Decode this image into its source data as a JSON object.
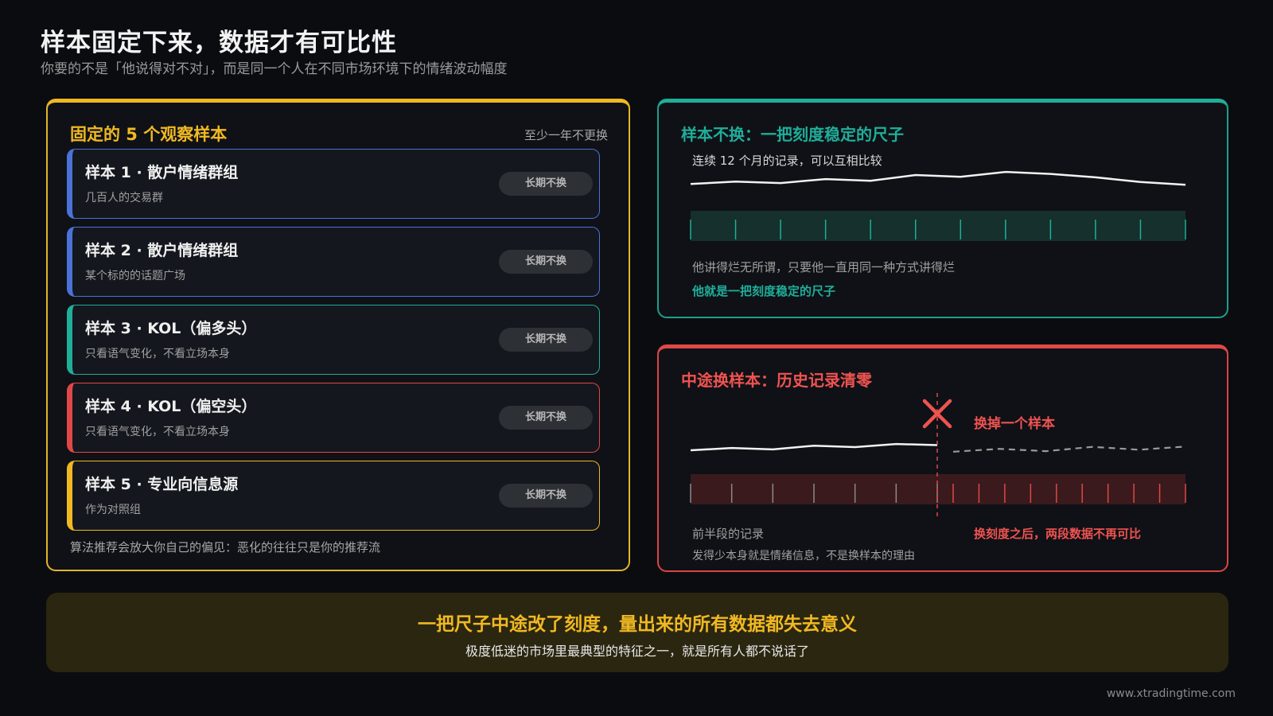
{
  "header": {
    "title": "样本固定下来，数据才有可比性",
    "subtitle": "你要的不是「他说得对不对」，而是同一个人在不同市场环境下的情绪波动幅度"
  },
  "left_panel": {
    "title": "固定的 5 个观察样本",
    "note": "至少一年不更换",
    "footer": "算法推荐会放大你自己的偏见：恶化的往往只是你的推荐流",
    "samples": [
      {
        "title": "样本 1 · 散户情绪群组",
        "desc": "几百人的交易群",
        "badge": "长期不换",
        "color": "#4a72d9"
      },
      {
        "title": "样本 2 · 散户情绪群组",
        "desc": "某个标的的话题广场",
        "badge": "长期不换",
        "color": "#4a72d9"
      },
      {
        "title": "样本 3 · KOL（偏多头）",
        "desc": "只看语气变化，不看立场本身",
        "badge": "长期不换",
        "color": "#1fae9a"
      },
      {
        "title": "样本 4 · KOL（偏空头）",
        "desc": "只看语气变化，不看立场本身",
        "badge": "长期不换",
        "color": "#e04848"
      },
      {
        "title": "样本 5 · 专业向信息源",
        "desc": "作为对照组",
        "badge": "长期不换",
        "color": "#f0b922"
      }
    ]
  },
  "top_right": {
    "title": "样本不换：一把刻度稳定的尺子",
    "subtitle": "连续 12 个月的记录，可以互相比较",
    "line1": "他讲得烂无所谓，只要他一直用同一种方式讲得烂",
    "line2": "他就是一把刻度稳定的尺子",
    "accent": "#1fae9a",
    "series": [
      0.55,
      0.63,
      0.58,
      0.72,
      0.66,
      0.86,
      0.8,
      0.97,
      0.9,
      0.78,
      0.62,
      0.52
    ]
  },
  "bottom_right": {
    "title": "中途换样本：历史记录清零",
    "marker_label": "换掉一个样本",
    "left_caption": "前半段的记录",
    "right_caption": "换刻度之后，两段数据不再可比",
    "note": "发得少本身就是情绪信息，不是换样本的理由",
    "accent": "#e04848",
    "series_before": [
      0.5,
      0.58,
      0.53,
      0.66,
      0.61,
      0.72,
      0.68
    ],
    "series_after": [
      0.45,
      0.55,
      0.47,
      0.62,
      0.52,
      0.63
    ]
  },
  "banner": {
    "main": "一把尺子中途改了刻度，量出来的所有数据都失去意义",
    "sub": "极度低迷的市场里最典型的特征之一，就是所有人都不说话了"
  },
  "footer": {
    "url": "www.xtradingtime.com"
  }
}
